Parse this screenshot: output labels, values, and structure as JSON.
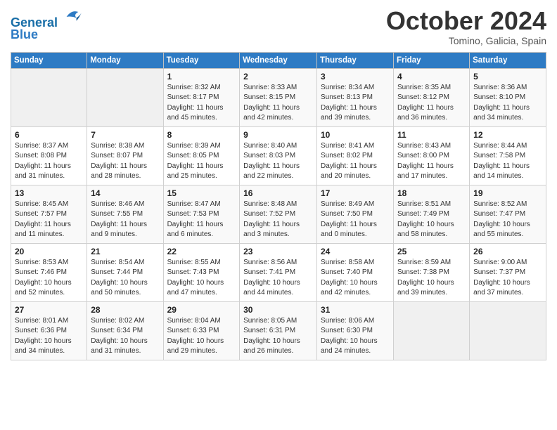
{
  "header": {
    "logo_line1": "General",
    "logo_line2": "Blue",
    "month": "October 2024",
    "location": "Tomino, Galicia, Spain"
  },
  "weekdays": [
    "Sunday",
    "Monday",
    "Tuesday",
    "Wednesday",
    "Thursday",
    "Friday",
    "Saturday"
  ],
  "weeks": [
    [
      {
        "day": "",
        "info": ""
      },
      {
        "day": "",
        "info": ""
      },
      {
        "day": "1",
        "info": "Sunrise: 8:32 AM\nSunset: 8:17 PM\nDaylight: 11 hours\nand 45 minutes."
      },
      {
        "day": "2",
        "info": "Sunrise: 8:33 AM\nSunset: 8:15 PM\nDaylight: 11 hours\nand 42 minutes."
      },
      {
        "day": "3",
        "info": "Sunrise: 8:34 AM\nSunset: 8:13 PM\nDaylight: 11 hours\nand 39 minutes."
      },
      {
        "day": "4",
        "info": "Sunrise: 8:35 AM\nSunset: 8:12 PM\nDaylight: 11 hours\nand 36 minutes."
      },
      {
        "day": "5",
        "info": "Sunrise: 8:36 AM\nSunset: 8:10 PM\nDaylight: 11 hours\nand 34 minutes."
      }
    ],
    [
      {
        "day": "6",
        "info": "Sunrise: 8:37 AM\nSunset: 8:08 PM\nDaylight: 11 hours\nand 31 minutes."
      },
      {
        "day": "7",
        "info": "Sunrise: 8:38 AM\nSunset: 8:07 PM\nDaylight: 11 hours\nand 28 minutes."
      },
      {
        "day": "8",
        "info": "Sunrise: 8:39 AM\nSunset: 8:05 PM\nDaylight: 11 hours\nand 25 minutes."
      },
      {
        "day": "9",
        "info": "Sunrise: 8:40 AM\nSunset: 8:03 PM\nDaylight: 11 hours\nand 22 minutes."
      },
      {
        "day": "10",
        "info": "Sunrise: 8:41 AM\nSunset: 8:02 PM\nDaylight: 11 hours\nand 20 minutes."
      },
      {
        "day": "11",
        "info": "Sunrise: 8:43 AM\nSunset: 8:00 PM\nDaylight: 11 hours\nand 17 minutes."
      },
      {
        "day": "12",
        "info": "Sunrise: 8:44 AM\nSunset: 7:58 PM\nDaylight: 11 hours\nand 14 minutes."
      }
    ],
    [
      {
        "day": "13",
        "info": "Sunrise: 8:45 AM\nSunset: 7:57 PM\nDaylight: 11 hours\nand 11 minutes."
      },
      {
        "day": "14",
        "info": "Sunrise: 8:46 AM\nSunset: 7:55 PM\nDaylight: 11 hours\nand 9 minutes."
      },
      {
        "day": "15",
        "info": "Sunrise: 8:47 AM\nSunset: 7:53 PM\nDaylight: 11 hours\nand 6 minutes."
      },
      {
        "day": "16",
        "info": "Sunrise: 8:48 AM\nSunset: 7:52 PM\nDaylight: 11 hours\nand 3 minutes."
      },
      {
        "day": "17",
        "info": "Sunrise: 8:49 AM\nSunset: 7:50 PM\nDaylight: 11 hours\nand 0 minutes."
      },
      {
        "day": "18",
        "info": "Sunrise: 8:51 AM\nSunset: 7:49 PM\nDaylight: 10 hours\nand 58 minutes."
      },
      {
        "day": "19",
        "info": "Sunrise: 8:52 AM\nSunset: 7:47 PM\nDaylight: 10 hours\nand 55 minutes."
      }
    ],
    [
      {
        "day": "20",
        "info": "Sunrise: 8:53 AM\nSunset: 7:46 PM\nDaylight: 10 hours\nand 52 minutes."
      },
      {
        "day": "21",
        "info": "Sunrise: 8:54 AM\nSunset: 7:44 PM\nDaylight: 10 hours\nand 50 minutes."
      },
      {
        "day": "22",
        "info": "Sunrise: 8:55 AM\nSunset: 7:43 PM\nDaylight: 10 hours\nand 47 minutes."
      },
      {
        "day": "23",
        "info": "Sunrise: 8:56 AM\nSunset: 7:41 PM\nDaylight: 10 hours\nand 44 minutes."
      },
      {
        "day": "24",
        "info": "Sunrise: 8:58 AM\nSunset: 7:40 PM\nDaylight: 10 hours\nand 42 minutes."
      },
      {
        "day": "25",
        "info": "Sunrise: 8:59 AM\nSunset: 7:38 PM\nDaylight: 10 hours\nand 39 minutes."
      },
      {
        "day": "26",
        "info": "Sunrise: 9:00 AM\nSunset: 7:37 PM\nDaylight: 10 hours\nand 37 minutes."
      }
    ],
    [
      {
        "day": "27",
        "info": "Sunrise: 8:01 AM\nSunset: 6:36 PM\nDaylight: 10 hours\nand 34 minutes."
      },
      {
        "day": "28",
        "info": "Sunrise: 8:02 AM\nSunset: 6:34 PM\nDaylight: 10 hours\nand 31 minutes."
      },
      {
        "day": "29",
        "info": "Sunrise: 8:04 AM\nSunset: 6:33 PM\nDaylight: 10 hours\nand 29 minutes."
      },
      {
        "day": "30",
        "info": "Sunrise: 8:05 AM\nSunset: 6:31 PM\nDaylight: 10 hours\nand 26 minutes."
      },
      {
        "day": "31",
        "info": "Sunrise: 8:06 AM\nSunset: 6:30 PM\nDaylight: 10 hours\nand 24 minutes."
      },
      {
        "day": "",
        "info": ""
      },
      {
        "day": "",
        "info": ""
      }
    ]
  ]
}
